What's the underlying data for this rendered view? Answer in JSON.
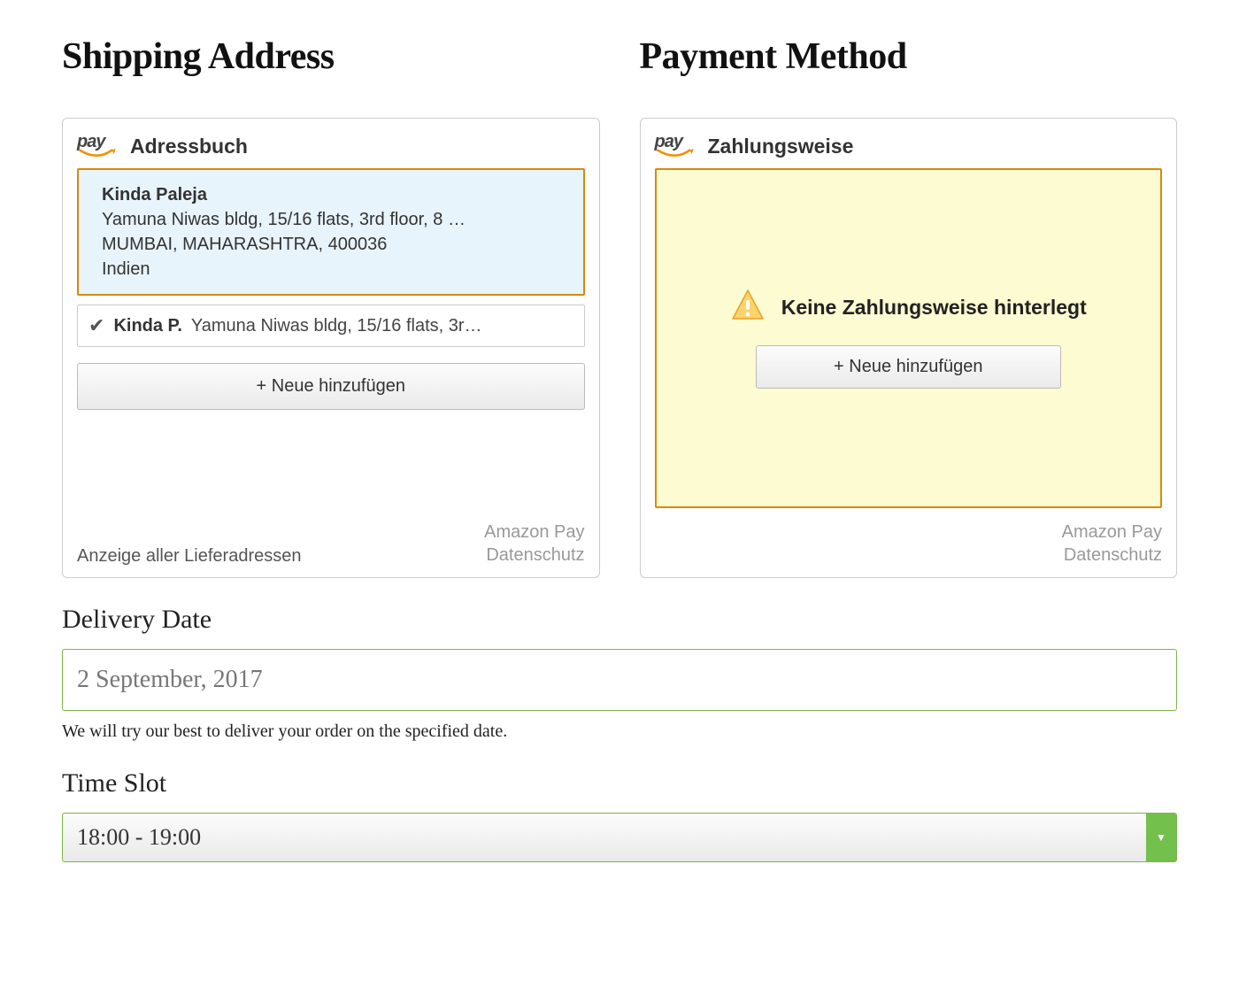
{
  "shipping": {
    "title": "Shipping Address",
    "panelTitle": "Adressbuch",
    "selected": {
      "name": "Kinda Paleja",
      "line1": "Yamuna Niwas bldg, 15/16 flats, 3rd floor, 8 …",
      "line2": "MUMBAI, MAHARASHTRA, 400036",
      "country": "Indien"
    },
    "option": {
      "name": "Kinda P.",
      "rest": "Yamuna Niwas bldg, 15/16 flats, 3r…"
    },
    "addNew": "+ Neue hinzufügen",
    "footerLeft": "Anzeige aller Lieferadressen",
    "footerRight1": "Amazon Pay",
    "footerRight2": "Datenschutz"
  },
  "payment": {
    "title": "Payment Method",
    "panelTitle": "Zahlungsweise",
    "warning": "Keine Zahlungsweise hinterlegt",
    "addNew": "+ Neue hinzufügen",
    "footerRight1": "Amazon Pay",
    "footerRight2": "Datenschutz"
  },
  "payLogo": "pay",
  "delivery": {
    "label": "Delivery Date",
    "value": "2 September, 2017",
    "note": "We will try our best to deliver your order on the specified date."
  },
  "timeslot": {
    "label": "Time Slot",
    "value": "18:00 - 19:00"
  }
}
